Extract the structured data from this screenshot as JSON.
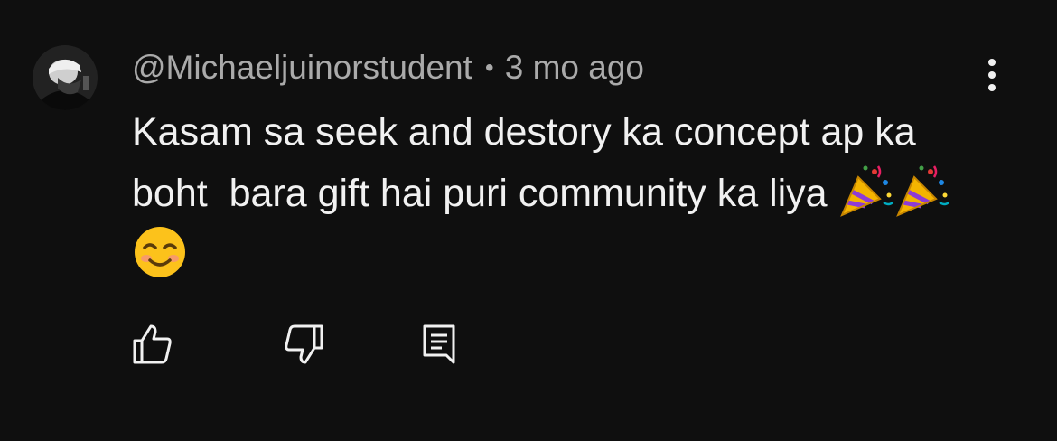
{
  "comment": {
    "author": "@Michaeljuinorstudent",
    "separator": "•",
    "time": "3 mo ago",
    "text": "Kasam sa seek and destory ka concept ap ka boht  bara gift hai puri community ka liya",
    "emojis": [
      "party-popper-emoji",
      "party-popper-emoji",
      "smiling-face-emoji"
    ]
  },
  "icons": {
    "avatar": "avatar",
    "more": "more-vertical-icon",
    "like": "thumbs-up-icon",
    "dislike": "thumbs-down-icon",
    "reply": "reply-comment-icon"
  },
  "colors": {
    "background": "#0f0f0f",
    "text": "#f1f1f1",
    "meta": "#aaaaaa"
  }
}
